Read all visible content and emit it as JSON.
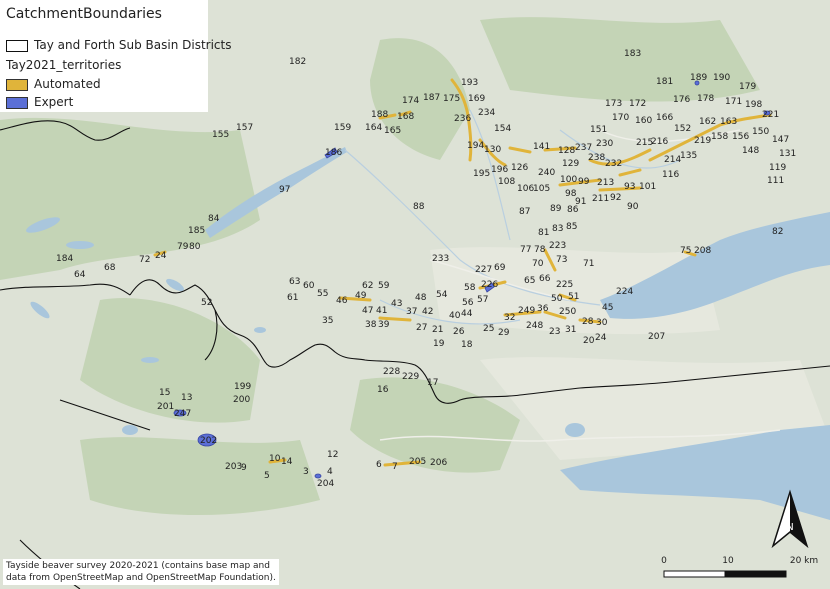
{
  "legend": {
    "title": "CatchmentBoundaries",
    "boundary_item": "Tay and Forth Sub Basin Districts",
    "layer_title": "Tay2021_territories",
    "items": [
      {
        "label": "Automated",
        "color": "#e0b43a"
      },
      {
        "label": "Expert",
        "color": "#5b6fd6"
      }
    ]
  },
  "credit": "Tayside beaver survey 2020-2021 (contains base map and data from OpenStreetMap and OpenStreetMap Foundation).",
  "scalebar": {
    "labels": [
      "0",
      "10",
      "20 km"
    ]
  },
  "north_arrow": "N",
  "colors": {
    "land": "#d9dfd2",
    "water": "#a9c6dc",
    "forest": "#b7ccaa",
    "boundary": "#111111",
    "automated": "#e0b43a",
    "expert": "#5b6fd6"
  },
  "territory_labels": [
    "182",
    "183",
    "181",
    "189",
    "190",
    "179",
    "193",
    "187",
    "175",
    "174",
    "169",
    "176",
    "178",
    "171",
    "198",
    "221",
    "168",
    "188",
    "165",
    "164",
    "159",
    "157",
    "155",
    "236",
    "234",
    "173",
    "172",
    "170",
    "160",
    "166",
    "152",
    "162",
    "163",
    "150",
    "147",
    "154",
    "186",
    "194",
    "130",
    "196",
    "126",
    "141",
    "128",
    "237",
    "151",
    "230",
    "215",
    "216",
    "158",
    "156",
    "148",
    "131",
    "219",
    "135",
    "97",
    "195",
    "108",
    "240",
    "129",
    "238",
    "232",
    "213",
    "214",
    "116",
    "119",
    "111",
    "106",
    "105",
    "91",
    "100",
    "99",
    "98",
    "211",
    "92",
    "93",
    "101",
    "90",
    "84",
    "185",
    "79",
    "80",
    "24",
    "72",
    "68",
    "64",
    "63",
    "60",
    "61",
    "62",
    "59",
    "55",
    "46",
    "49",
    "47",
    "41",
    "43",
    "37",
    "38",
    "39",
    "58",
    "56",
    "57",
    "48",
    "54",
    "42",
    "40",
    "44",
    "226",
    "227",
    "69",
    "233",
    "65",
    "66",
    "225",
    "224",
    "45",
    "50",
    "51",
    "52",
    "35",
    "32",
    "249",
    "248",
    "36",
    "250",
    "28",
    "30",
    "23",
    "31",
    "20",
    "24",
    "207",
    "75",
    "208",
    "82",
    "81",
    "83",
    "85",
    "89",
    "87",
    "86",
    "77",
    "78",
    "223",
    "73",
    "71",
    "70",
    "27",
    "21",
    "19",
    "26",
    "18",
    "25",
    "29",
    "228",
    "229",
    "17",
    "16",
    "15",
    "13",
    "199",
    "200",
    "201",
    "247",
    "202",
    "203",
    "9",
    "10",
    "14",
    "5",
    "3",
    "4",
    "204",
    "12",
    "6",
    "205",
    "206",
    "7",
    "88",
    "184"
  ]
}
